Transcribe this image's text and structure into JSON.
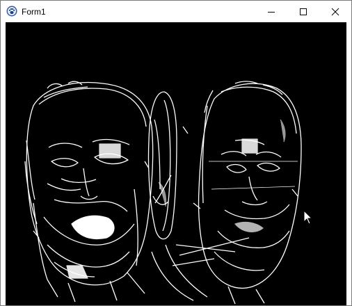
{
  "window": {
    "title": "Form1",
    "icons": {
      "app": "paw-app-icon",
      "minimize": "minimize-icon",
      "maximize": "maximize-icon",
      "close": "close-icon"
    }
  },
  "canvas": {
    "background": "#000000",
    "stroke": "#ffffff",
    "content": "edge-detected-image"
  },
  "cursor": {
    "icon": "mouse-pointer-icon"
  }
}
